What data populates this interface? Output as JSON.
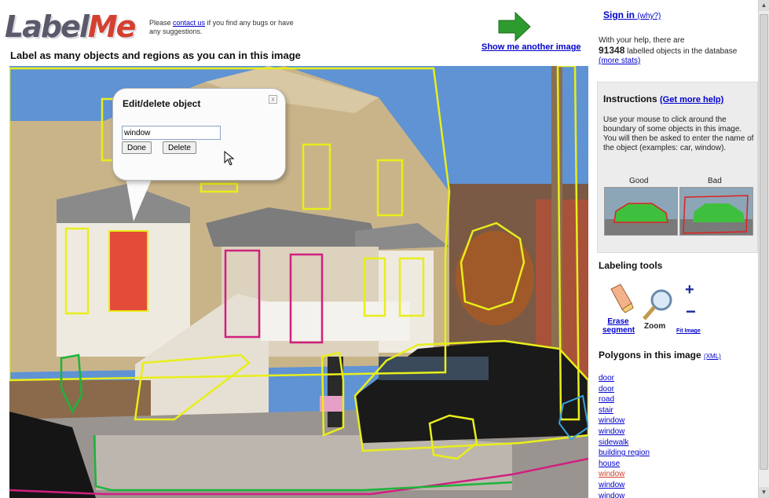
{
  "header": {
    "logo_main": "Label",
    "logo_accent": "Me",
    "note_prefix": "Please ",
    "contact_link": "contact us",
    "note_suffix": " if you find any bugs or have any suggestions.",
    "page_heading": "Label as many objects and regions as you can in this image",
    "next_image_link": "Show me another image"
  },
  "popup": {
    "title": "Edit/delete object",
    "close_glyph": "x",
    "input_value": "window",
    "done_label": "Done",
    "delete_label": "Delete"
  },
  "sidebar": {
    "signin_label": "Sign in",
    "why_label": "(why?)",
    "stats_prefix": "With your help, there are",
    "stats_count": "91348",
    "stats_suffix": " labelled objects in the database",
    "more_stats_label": "(more stats)",
    "instructions_title": "Instructions",
    "instructions_help": "(Get more help)",
    "instructions_body": "Use your mouse to click around the boundary of some objects in this image. You will then be asked to enter the name of the object (examples: car, window).",
    "good_label": "Good",
    "bad_label": "Bad",
    "tools_title": "Labeling tools",
    "erase_label": "Erase segment",
    "zoom_label": "Zoom",
    "plus_glyph": "+",
    "minus_glyph": "−",
    "fit_label": "Fit Image",
    "polygons_title": "Polygons in this image",
    "xml_label": "(XML)",
    "polygons": [
      {
        "label": "door",
        "selected": false
      },
      {
        "label": "door",
        "selected": false
      },
      {
        "label": "road",
        "selected": false
      },
      {
        "label": "stair",
        "selected": false
      },
      {
        "label": "window",
        "selected": false
      },
      {
        "label": "window",
        "selected": false
      },
      {
        "label": "sidewalk",
        "selected": false
      },
      {
        "label": "building region",
        "selected": false
      },
      {
        "label": "house",
        "selected": false
      },
      {
        "label": "window",
        "selected": true
      },
      {
        "label": "window",
        "selected": false
      },
      {
        "label": "window",
        "selected": false
      }
    ]
  },
  "colors": {
    "link": "#0000cc",
    "selected": "#d4402f",
    "polygon_yellow": "#e8ee1a",
    "polygon_magenta": "#d0207f",
    "polygon_green": "#1db43a",
    "polygon_selected_fill": "#e0301a",
    "arrow_green": "#2e9b2e"
  },
  "icons": {
    "next_arrow": "right-arrow-icon",
    "erase": "eraser-icon",
    "zoom": "magnifier-icon",
    "cursor": "mouse-pointer-icon"
  }
}
